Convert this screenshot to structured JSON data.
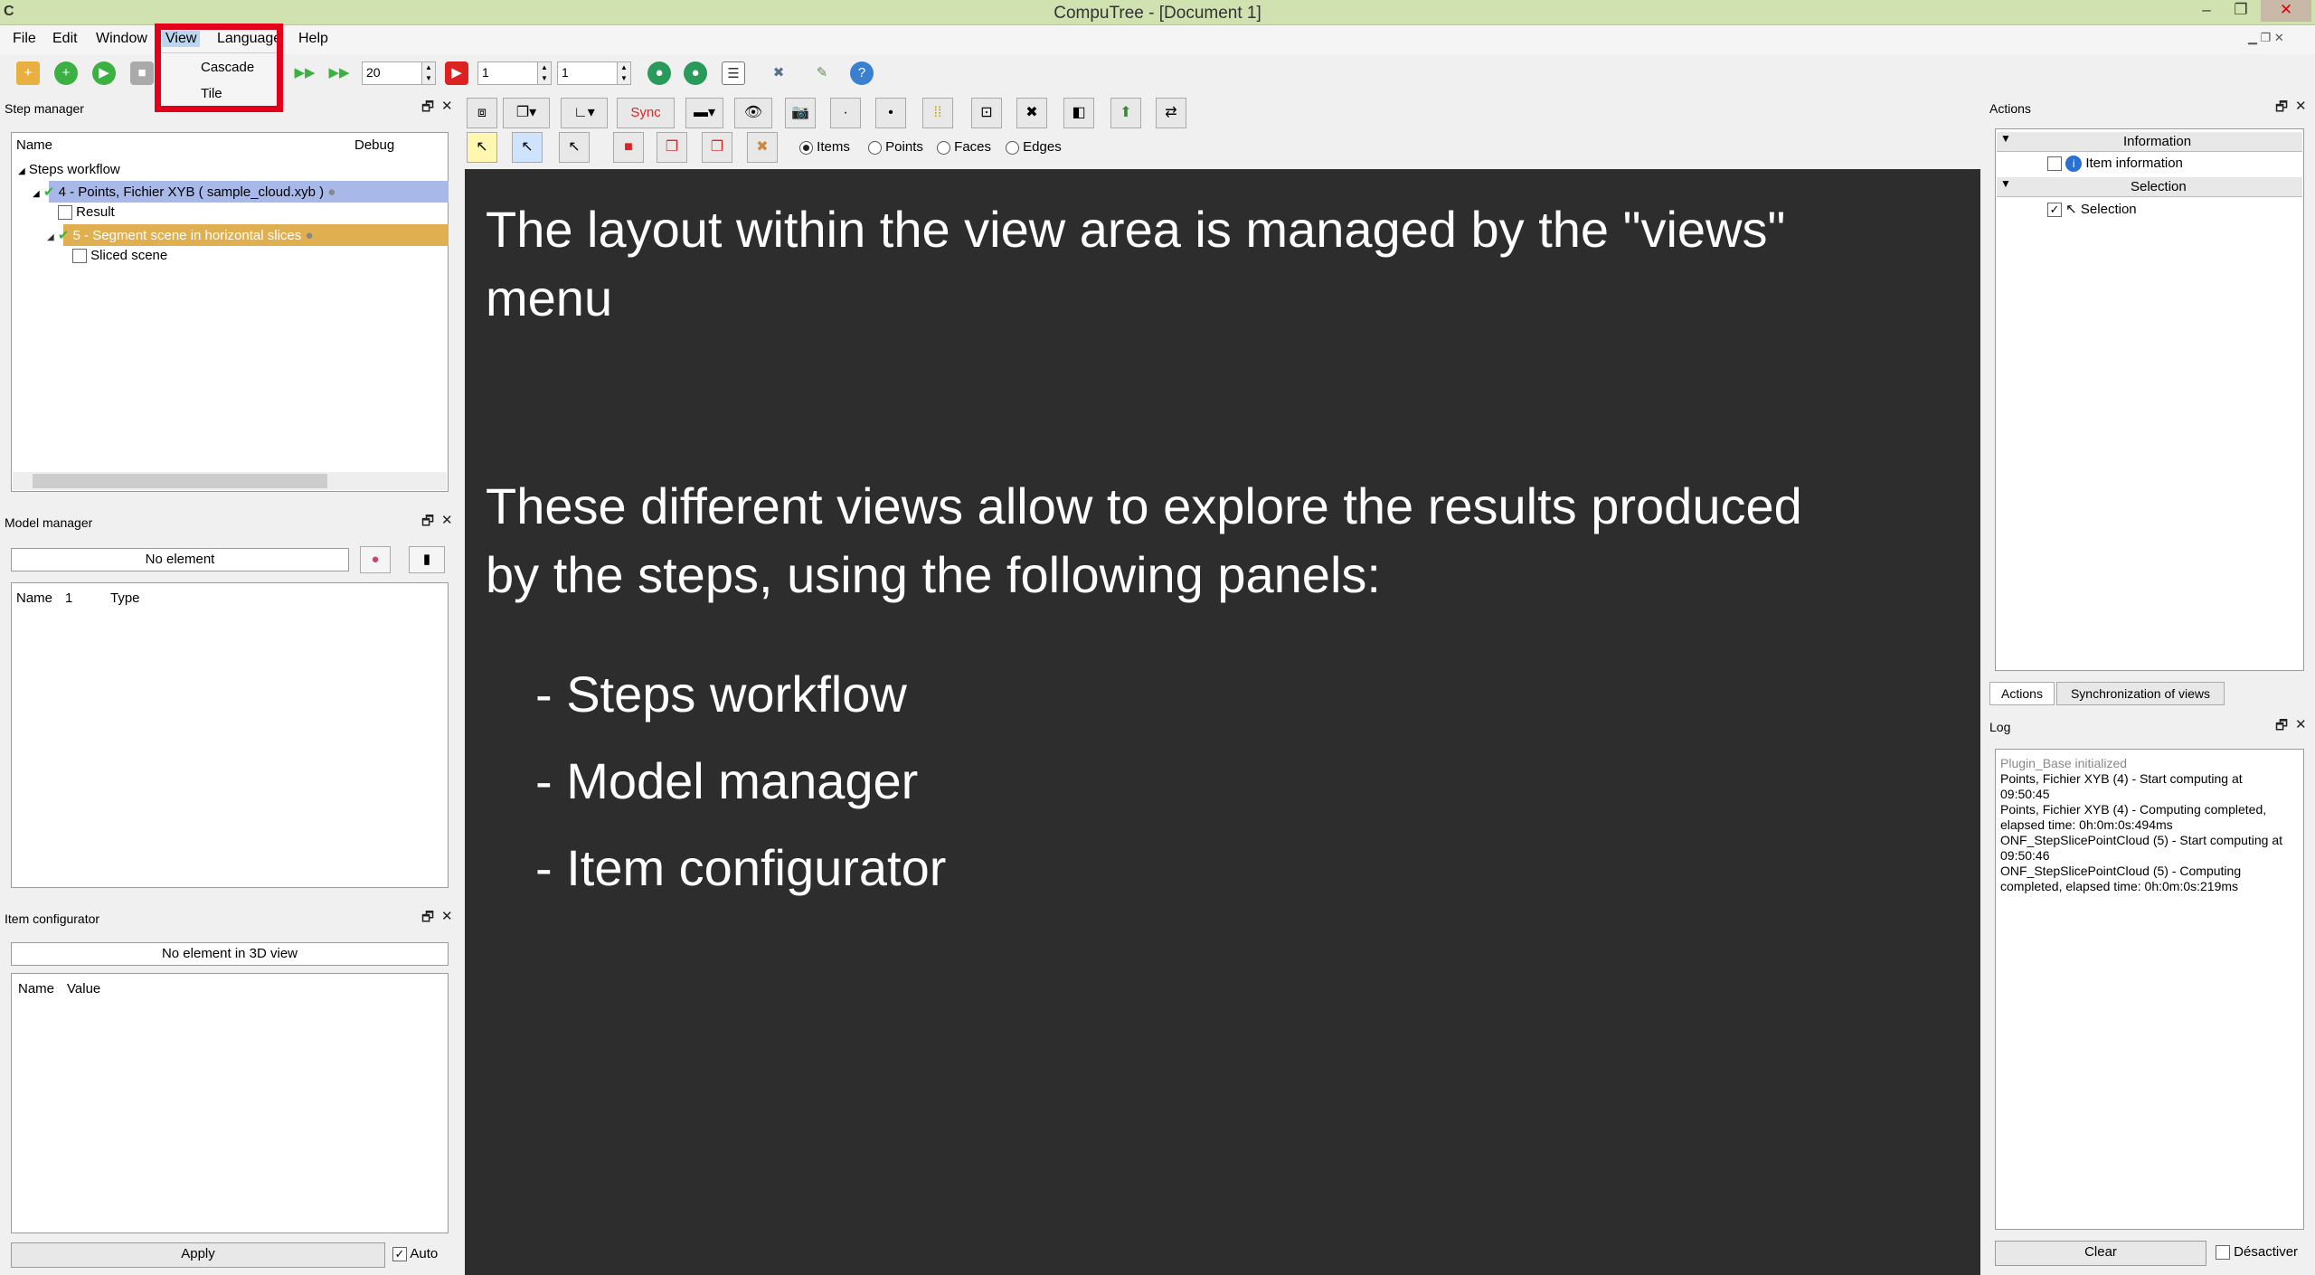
{
  "window": {
    "title": "CompuTree - [Document 1]",
    "app_icon": "C"
  },
  "menu": {
    "items": [
      "File",
      "Edit",
      "Window",
      "View",
      "Language",
      "Help"
    ]
  },
  "view_menu": {
    "items": [
      "Cascade",
      "Tile"
    ]
  },
  "toolbar": {
    "speed_value": "20",
    "spin1_value": "1",
    "spin2_value": "1"
  },
  "step_manager": {
    "title": "Step manager",
    "col_name": "Name",
    "col_debug": "Debug",
    "root": "Steps workflow",
    "step4": "4 - Points, Fichier XYB ( sample_cloud.xyb )",
    "result": "Result",
    "step5": "5 - Segment scene in horizontal slices",
    "sliced": "Sliced scene"
  },
  "model_manager": {
    "title": "Model manager",
    "combo": "No element",
    "col_name": "Name",
    "col_1": "1",
    "col_type": "Type"
  },
  "item_configurator": {
    "title": "Item configurator",
    "combo": "No element in 3D view",
    "col_name": "Name",
    "col_value": "Value",
    "apply": "Apply",
    "auto": "Auto"
  },
  "view_toolbar": {
    "sync": "Sync",
    "radio_items": "Items",
    "radio_points": "Points",
    "radio_faces": "Faces",
    "radio_edges": "Edges"
  },
  "view_text": {
    "line1": "The layout within the view area is managed by the \"views\"",
    "line2": "menu",
    "line3": "These different views allow to explore the results produced",
    "line4": "by the steps, using the following panels:",
    "bullet1": "- Steps workflow",
    "bullet2": "- Model manager",
    "bullet3": "- Item configurator"
  },
  "actions": {
    "title": "Actions",
    "group_information": "Information",
    "item_information": "Item information",
    "group_selection": "Selection",
    "item_selection": "Selection",
    "tab_actions": "Actions",
    "tab_sync": "Synchronization of views"
  },
  "log": {
    "title": "Log",
    "lines": [
      "Plugin_Base initialized",
      "Points, Fichier XYB (4) - Start computing at",
      "09:50:45",
      "Points, Fichier XYB (4) - Computing completed,",
      "elapsed time: 0h:0m:0s:494ms",
      "ONF_StepSlicePointCloud (5) - Start computing at",
      "09:50:46",
      "ONF_StepSlicePointCloud (5) - Computing",
      "completed, elapsed time: 0h:0m:0s:219ms"
    ],
    "clear": "Clear",
    "desactiver": "Désactiver"
  }
}
